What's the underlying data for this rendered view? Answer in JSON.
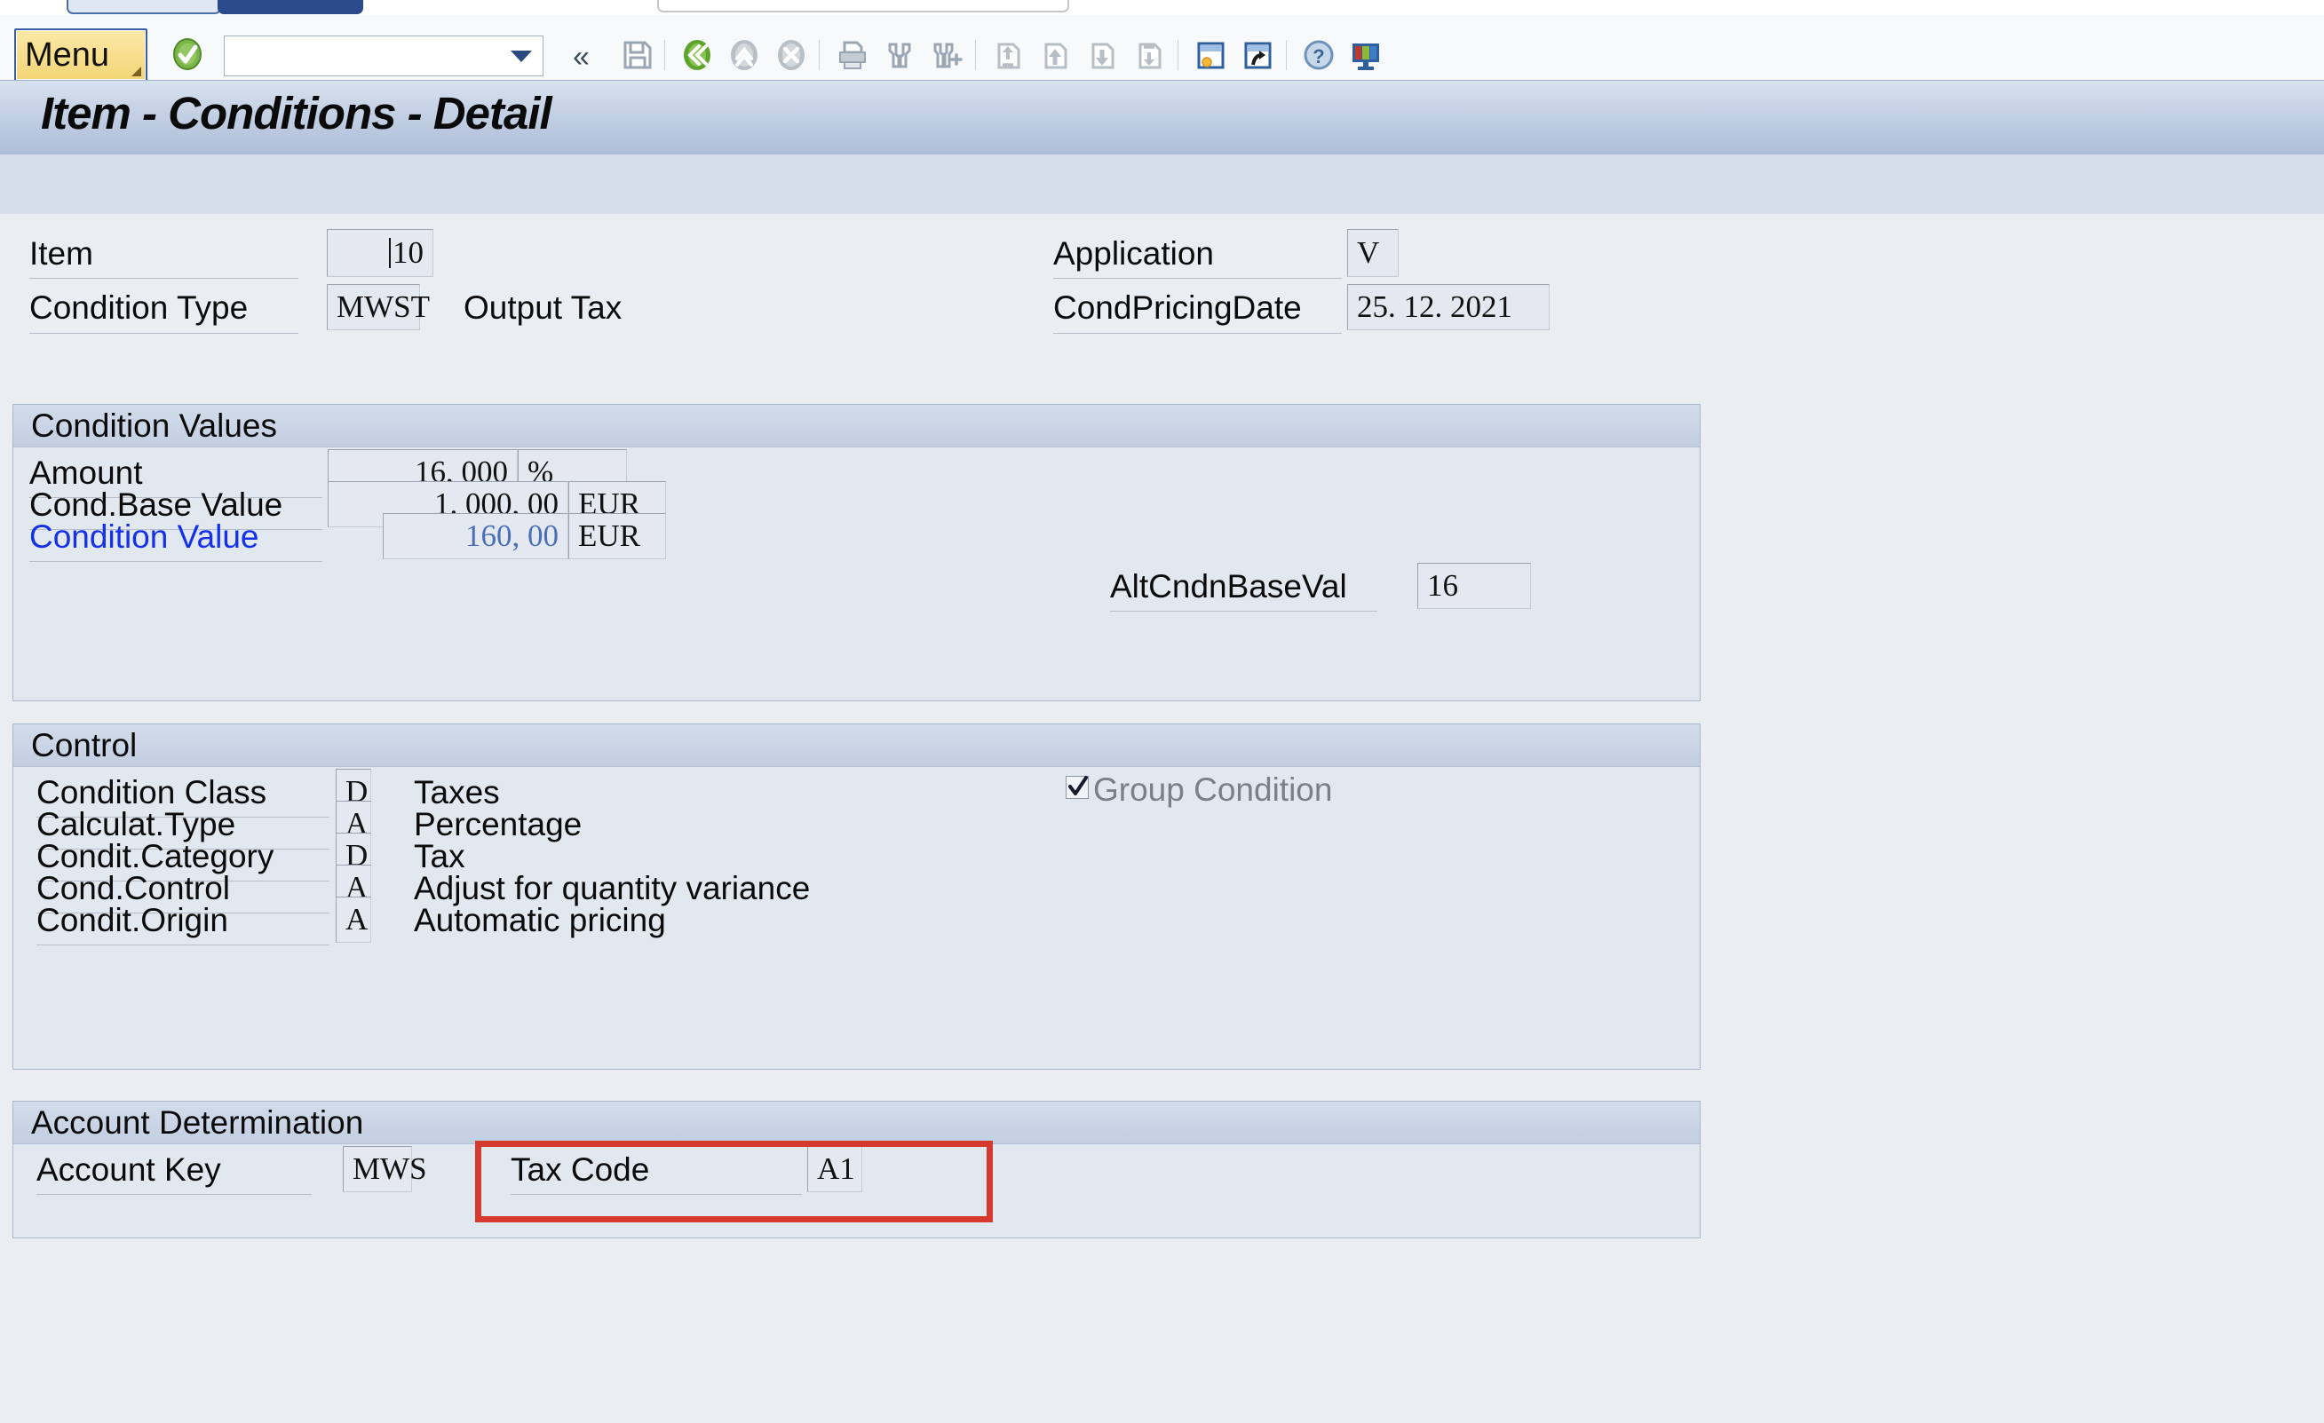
{
  "toolbar": {
    "menu_label": "Menu",
    "command_field_value": "",
    "command_field_placeholder": "",
    "icons": [
      {
        "name": "ok-enter-icon",
        "title": "Enter"
      },
      {
        "name": "save-icon",
        "title": "Save"
      },
      {
        "name": "back-icon",
        "title": "Back"
      },
      {
        "name": "exit-icon",
        "title": "Exit"
      },
      {
        "name": "cancel-icon",
        "title": "Cancel"
      },
      {
        "name": "print-icon",
        "title": "Print"
      },
      {
        "name": "find-icon",
        "title": "Find"
      },
      {
        "name": "find-next-icon",
        "title": "Find Next"
      },
      {
        "name": "first-page-icon",
        "title": "First Page"
      },
      {
        "name": "previous-page-icon",
        "title": "Previous Page"
      },
      {
        "name": "next-page-icon",
        "title": "Next Page"
      },
      {
        "name": "last-page-icon",
        "title": "Last Page"
      },
      {
        "name": "new-session-icon",
        "title": "Create New Session"
      },
      {
        "name": "create-shortcut-icon",
        "title": "Create Shortcut"
      },
      {
        "name": "help-icon",
        "title": "Help"
      },
      {
        "name": "customize-layout-icon",
        "title": "Customize Local Layout"
      }
    ],
    "collapse_chevron": "«"
  },
  "title": "Item - Conditions - Detail",
  "header": {
    "item": {
      "label": "Item",
      "value": "10"
    },
    "condition_type": {
      "label": "Condition Type",
      "value": "MWST",
      "description": "Output Tax"
    },
    "application": {
      "label": "Application",
      "value": "V"
    },
    "cond_pricing_date": {
      "label": "CondPricingDate",
      "value": "25. 12. 2021"
    }
  },
  "condition_values": {
    "section_title": "Condition Values",
    "amount": {
      "label": "Amount",
      "value": "16, 000",
      "unit": "%"
    },
    "cond_base_value": {
      "label": "Cond.Base Value",
      "value": "1. 000, 00",
      "unit": "EUR"
    },
    "condition_value": {
      "label": "Condition Value",
      "value": "160, 00",
      "unit": "EUR"
    },
    "alt_cndn_base_val": {
      "label": "AltCndnBaseVal",
      "value": "16"
    }
  },
  "control": {
    "section_title": "Control",
    "rows": [
      {
        "label": "Condition Class",
        "code": "D",
        "description": "Taxes"
      },
      {
        "label": "Calculat.Type",
        "code": "A",
        "description": "Percentage"
      },
      {
        "label": "Condit.Category",
        "code": "D",
        "description": "Tax"
      },
      {
        "label": "Cond.Control",
        "code": "A",
        "description": "Adjust for quantity variance"
      },
      {
        "label": "Condit.Origin",
        "code": "A",
        "description": "Automatic pricing"
      }
    ],
    "group_condition": {
      "label": "Group Condition",
      "checked": true,
      "disabled": true
    }
  },
  "account_determination": {
    "section_title": "Account Determination",
    "account_key": {
      "label": "Account Key",
      "value": "MWS"
    },
    "tax_code": {
      "label": "Tax Code",
      "value": "A1"
    }
  },
  "annotation": {
    "highlight_color": "#d63a2f",
    "target": "Tax Code"
  }
}
